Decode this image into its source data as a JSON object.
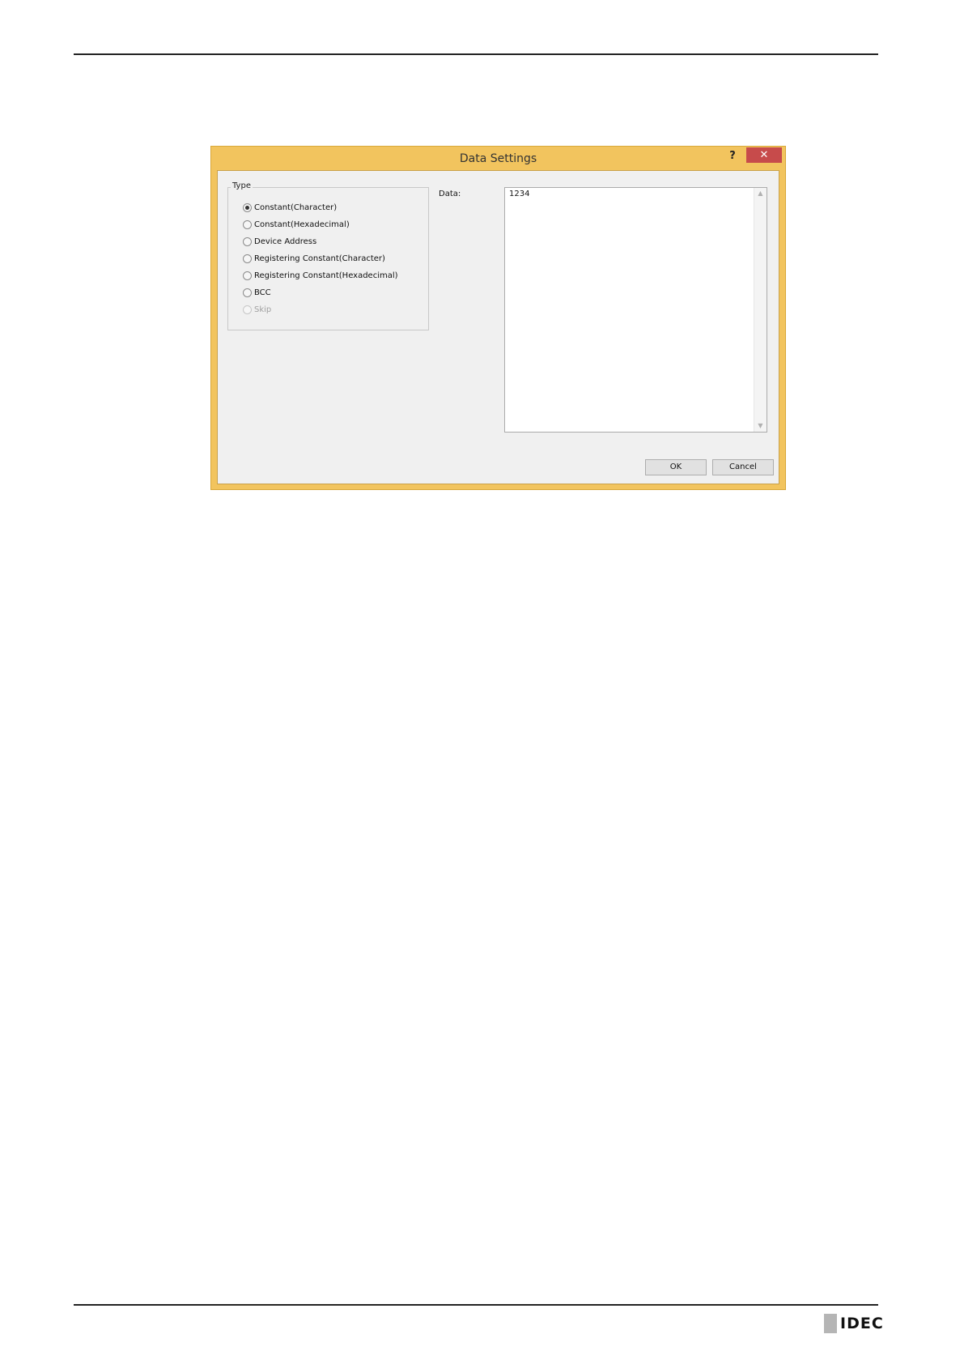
{
  "dialog": {
    "title": "Data Settings",
    "help_label": "?",
    "close_label": "✕"
  },
  "type_group": {
    "label": "Type",
    "options": [
      {
        "label": "Constant(Character)",
        "checked": true,
        "enabled": true
      },
      {
        "label": "Constant(Hexadecimal)",
        "checked": false,
        "enabled": true
      },
      {
        "label": "Device Address",
        "checked": false,
        "enabled": true
      },
      {
        "label": "Registering Constant(Character)",
        "checked": false,
        "enabled": true
      },
      {
        "label": "Registering Constant(Hexadecimal)",
        "checked": false,
        "enabled": true
      },
      {
        "label": "BCC",
        "checked": false,
        "enabled": true
      },
      {
        "label": "Skip",
        "checked": false,
        "enabled": false
      }
    ]
  },
  "data_field": {
    "label": "Data:",
    "value": "1234"
  },
  "buttons": {
    "ok_label": "OK",
    "cancel_label": "Cancel"
  },
  "footer": {
    "brand": "IDEC"
  },
  "colors": {
    "window_frame": "#f2c45e",
    "close_button": "#c74b4b",
    "client_bg": "#f0f0f0"
  }
}
